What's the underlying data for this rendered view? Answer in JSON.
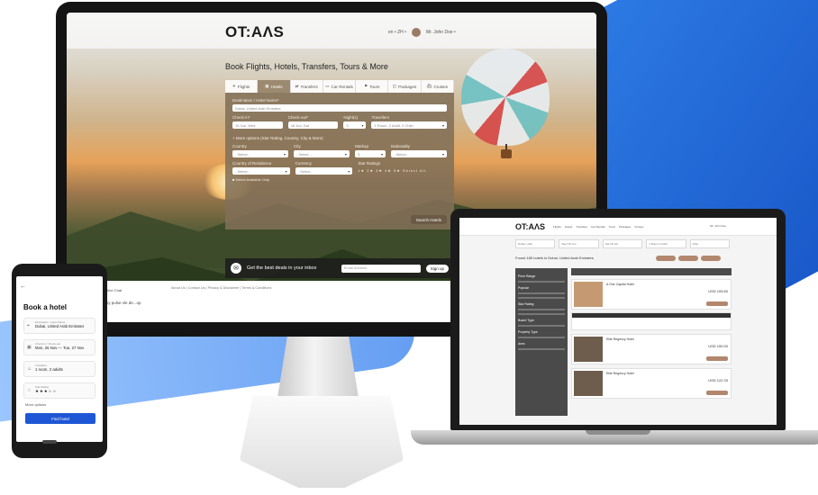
{
  "desktop": {
    "logo": "OT:AɅS",
    "header_right": "en •  ZH •",
    "user": "Mr. John Doe •",
    "hero_title": "Book Flights, Hotels, Transfers, Tours & More",
    "tabs": [
      {
        "icon": "flight-icon",
        "label": "Flights"
      },
      {
        "icon": "hotel-icon",
        "label": "Hotels"
      },
      {
        "icon": "transfer-icon",
        "label": "Transfers"
      },
      {
        "icon": "car-icon",
        "label": "Car Rentals"
      },
      {
        "icon": "tour-icon",
        "label": "Tours"
      },
      {
        "icon": "package-icon",
        "label": "Packages"
      },
      {
        "icon": "cruise-icon",
        "label": "Cruises"
      }
    ],
    "search": {
      "destination_label": "Destination / Hotel Name*",
      "destination_value": "Dubai, United Arab Emirates",
      "checkin_label": "Check-in*",
      "checkin_value": "15 Jun, Wed",
      "checkout_label": "Check-out*",
      "checkout_value": "18 Jun, Sat",
      "nights_label": "Night(s)",
      "nights_value": "3",
      "travellers_label": "Travellers",
      "travellers_value": "1 Room, 2 Adult, 0 Child",
      "more_options": "+ More options (Star Rating, Country, City & More)",
      "country_label": "Country",
      "city_label": "City",
      "markup_label": "Markup",
      "nationality_label": "Nationality",
      "residence_label": "Country of Residence",
      "currency_label": "Currency",
      "star_label": "Star Ratings",
      "select_placeholder": "- Select -",
      "stars_text": "1★  2★  3★  4★  5★  Select All",
      "available_only": "Select Available Only",
      "search_button": "Search Hotels"
    },
    "deals_text": "Get the best deals in your inbox",
    "email_placeholder": "Email Address",
    "signup_button": "Sign up",
    "footer_links": "About Us  |  Contact Us  |  Privacy & Disclaimer  |  Terms & Conditions",
    "chat_text": "Online Chat",
    "chat_text2": "...by pulse vle de...op"
  },
  "laptop": {
    "logo": "OT:AɅS",
    "nav": [
      "Flights",
      "Hotels",
      "Transfers",
      "Car Rentals",
      "Tours",
      "Packages",
      "Cruises",
      "Visa",
      "Insurance"
    ],
    "user": "Mr. John Doe",
    "search_fields": [
      "Dubai, UAE",
      "Wed 15 Jun",
      "Sat 18 Jun",
      "1 Room 2 Adult",
      "Filter"
    ],
    "results_title": "Found 185 hotels in Dubai, United Arab Emirates",
    "filters": [
      "Price Range",
      "Popular",
      "Star Rating",
      "Board Type",
      "Property Type",
      "Area"
    ],
    "hotels": [
      {
        "name": "A One Capital Hotel",
        "price": "USD 105.60"
      },
      {
        "name": "Elite Regency Hotel",
        "price": "USD 150.00"
      },
      {
        "name": "Elite Regency Hotel",
        "price": "USD 122.33"
      }
    ]
  },
  "phone": {
    "title": "Book a hotel",
    "fields": [
      {
        "icon": "location-icon",
        "key": "Destination / Hotel Name",
        "value": "Dubai, United Arab Emirates"
      },
      {
        "icon": "calendar-icon",
        "key": "Check-in / Check-out",
        "value": "Mon, 26 Nov — Tue, 27 Nov"
      },
      {
        "icon": "person-icon",
        "key": "Travellers",
        "value": "1 room, 2 adults"
      },
      {
        "icon": "star-icon",
        "key": "Star Rating",
        "value": "★★★☆☆"
      }
    ],
    "more_options": "More options",
    "find_button": "Find hotel"
  },
  "colors": {
    "accent": "#1d57d6",
    "brand_brown": "#9c8a70",
    "swoosh_blue": "#2f7fe8"
  }
}
